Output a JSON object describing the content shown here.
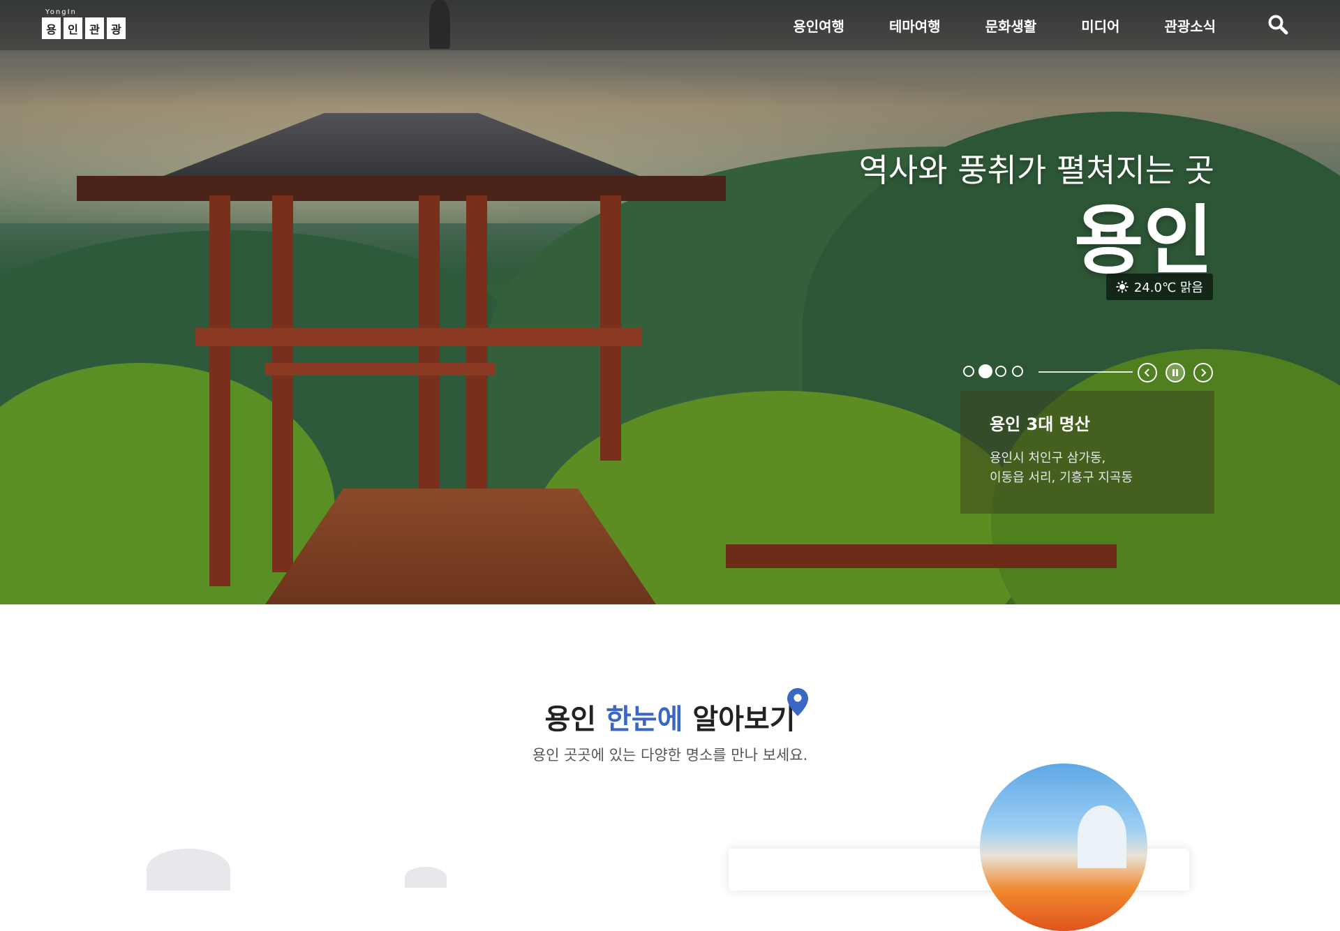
{
  "header": {
    "logo_small": "YongIn",
    "logo_chars": [
      "용",
      "인",
      "관",
      "광"
    ],
    "nav": [
      "용인여행",
      "테마여행",
      "문화생활",
      "미디어",
      "관광소식"
    ]
  },
  "hero": {
    "tagline": "역사와 풍취가 펼쳐지는 곳",
    "city": "용인",
    "weather": "24.0℃ 맑음",
    "caption_title": "용인 3대 명산",
    "caption_line1": "용인시 처인구 삼가동,",
    "caption_line2": "이동읍 서리, 기흥구 지곡동"
  },
  "section": {
    "title_prefix": "용인 ",
    "title_highlight": "한눈에",
    "title_suffix": " 알아보기",
    "subtitle": "용인 곳곳에 있는 다양한 명소를 만나 보세요."
  }
}
